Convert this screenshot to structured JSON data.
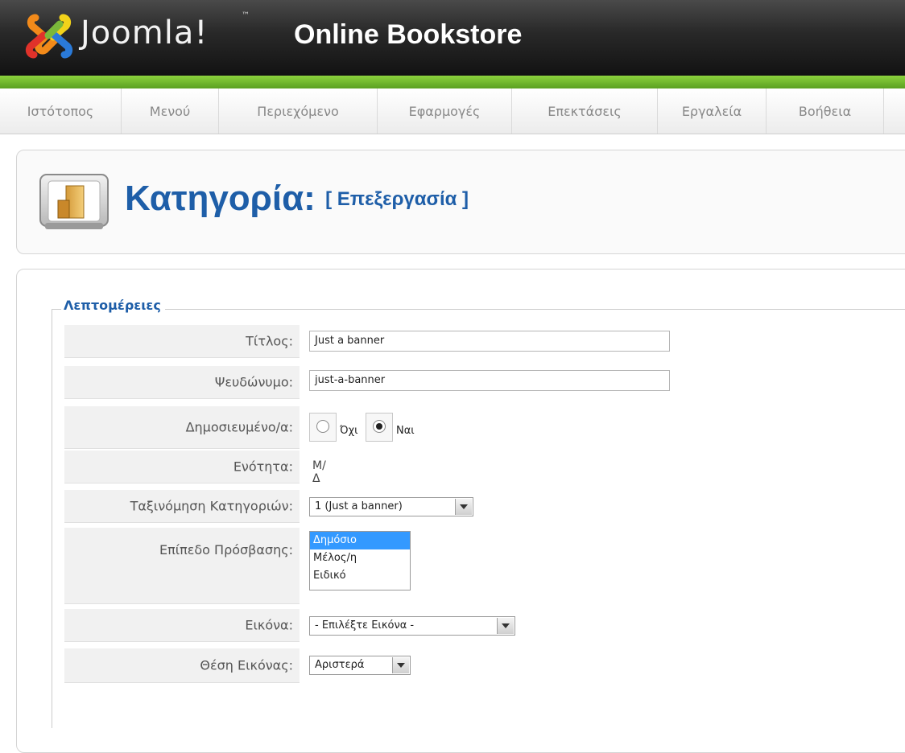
{
  "header": {
    "brand": "Joomla!",
    "trademark": "™",
    "site_name": "Online Bookstore",
    "colors": {
      "green_bar": "#6ab82b",
      "title_blue": "#1e5ea8"
    }
  },
  "menu": {
    "items": [
      {
        "label": "Ιστότοπος"
      },
      {
        "label": "Μενού"
      },
      {
        "label": "Περιεχόμενο"
      },
      {
        "label": "Εφαρμογές"
      },
      {
        "label": "Επεκτάσεις"
      },
      {
        "label": "Εργαλεία"
      },
      {
        "label": "Βοήθεια"
      }
    ]
  },
  "page": {
    "icon": "category-icon",
    "title": "Κατηγορία:",
    "subtitle": "[ Επεξεργασία ]"
  },
  "details": {
    "legend": "Λεπτομέρειες",
    "title": {
      "label": "Τίτλος:",
      "value": "Just a banner"
    },
    "alias": {
      "label": "Ψευδώνυμο:",
      "value": "just-a-banner"
    },
    "published": {
      "label": "Δημοσιευμένο/α:",
      "no": "Όχι",
      "yes": "Ναι",
      "selected": "Ναι"
    },
    "section": {
      "label": "Ενότητα:",
      "value": "Μ/Δ"
    },
    "ordering": {
      "label": "Ταξινόμηση Κατηγοριών:",
      "value": "1 (Just a banner)"
    },
    "access": {
      "label": "Επίπεδο Πρόσβασης:",
      "options": [
        "Δημόσιο",
        "Μέλος/η",
        "Ειδικό"
      ],
      "selected": "Δημόσιο"
    },
    "image": {
      "label": "Εικόνα:",
      "value": "- Επιλέξτε Εικόνα -"
    },
    "image_position": {
      "label": "Θέση Εικόνας:",
      "value": "Αριστερά"
    }
  }
}
